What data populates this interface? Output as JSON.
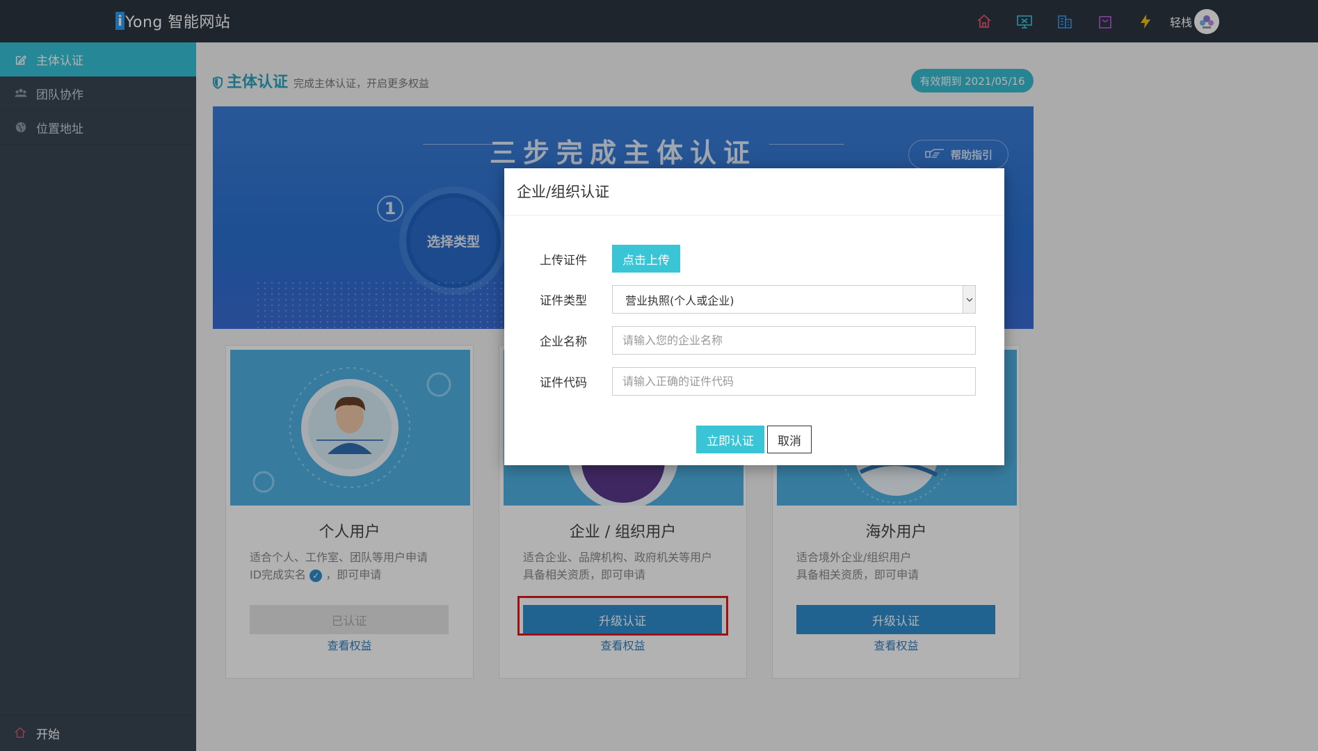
{
  "app": {
    "brand_letter": "i",
    "brand_name": "Yong 智能网站",
    "user_name": "轻栈"
  },
  "header_icons": [
    "home-icon",
    "monitor-icon",
    "building-icon",
    "shopping-bag-icon",
    "lightning-icon"
  ],
  "sidebar": {
    "items": [
      {
        "label": "主体认证",
        "icon": "edit-icon",
        "active": true
      },
      {
        "label": "团队协作",
        "icon": "users-icon",
        "active": false
      },
      {
        "label": "位置地址",
        "icon": "globe-icon",
        "active": false
      }
    ],
    "bottom_label": "开始"
  },
  "page": {
    "title": "主体认证",
    "subtitle": "完成主体认证，开启更多权益",
    "validity": "有效期到 2021/05/16"
  },
  "banner": {
    "title": "三步完成主体认证",
    "help_label": "帮助指引",
    "step_number": "1",
    "step_label": "选择类型"
  },
  "cards": [
    {
      "title": "个人用户",
      "desc_line1": "适合个人、工作室、团队等用户申请",
      "desc_line2_a": "ID完成实名",
      "desc_line2_b": "，即可申请",
      "button": "已认证",
      "link": "查看权益"
    },
    {
      "title": "企业 / 组织用户",
      "desc_line1": "适合企业、品牌机构、政府机关等用户",
      "desc_line2_a": "具备相关资质，即可申请",
      "button": "升级认证",
      "link": "查看权益"
    },
    {
      "title": "海外用户",
      "desc_line1": "适合境外企业/组织用户",
      "desc_line2_a": "具备相关资质，即可申请",
      "button": "升级认证",
      "link": "查看权益"
    }
  ],
  "modal": {
    "title": "企业/组织认证",
    "upload_label": "上传证件",
    "upload_button": "点击上传",
    "type_label": "证件类型",
    "type_value": "营业执照(个人或企业)",
    "name_label": "企业名称",
    "name_placeholder": "请输入您的企业名称",
    "code_label": "证件代码",
    "code_placeholder": "请输入正确的证件代码",
    "submit": "立即认证",
    "cancel": "取消"
  }
}
